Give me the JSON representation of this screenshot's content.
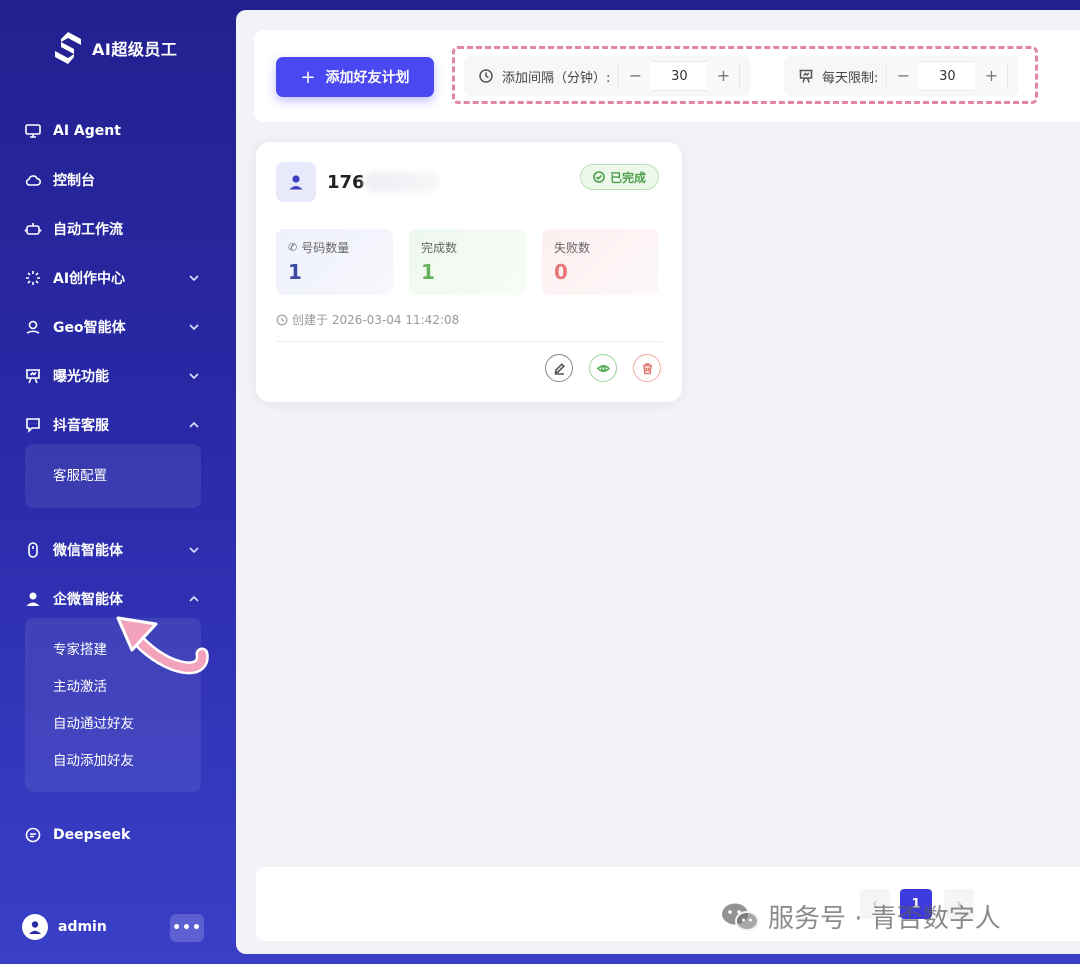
{
  "brand": {
    "name": "AI超级员工"
  },
  "sidebar": {
    "items": [
      {
        "label": "AI Agent",
        "icon": "monitor-icon"
      },
      {
        "label": "控制台",
        "icon": "cloud-icon"
      },
      {
        "label": "自动工作流",
        "icon": "robot-icon"
      },
      {
        "label": "AI创作中心",
        "icon": "sparkle-icon",
        "expanded": false
      },
      {
        "label": "Geo智能体",
        "icon": "map-pin-icon",
        "expanded": false
      },
      {
        "label": "曝光功能",
        "icon": "presentation-icon",
        "expanded": false
      },
      {
        "label": "抖音客服",
        "icon": "chat-icon",
        "expanded": true
      },
      {
        "label": "微信智能体",
        "icon": "mouse-icon",
        "expanded": false
      },
      {
        "label": "企微智能体",
        "icon": "user-icon",
        "expanded": true
      },
      {
        "label": "Deepseek",
        "icon": "message-icon"
      }
    ],
    "douyin_sub": [
      "客服配置"
    ],
    "qiwei_sub": [
      "专家搭建",
      "主动激活",
      "自动通过好友",
      "自动添加好友"
    ],
    "user": {
      "name": "admin",
      "more": "•••"
    }
  },
  "toolbar": {
    "add_button": "添加好友计划",
    "interval": {
      "label": "添加间隔（分钟）:",
      "value": "30"
    },
    "daily_limit": {
      "label": "每天限制:",
      "value": "30"
    }
  },
  "stepper": {
    "minus": "−",
    "plus": "+"
  },
  "card": {
    "title": "176",
    "status": "已完成",
    "stats": {
      "total": {
        "label": "号码数量",
        "value": "1"
      },
      "done": {
        "label": "完成数",
        "value": "1"
      },
      "fail": {
        "label": "失败数",
        "value": "0"
      }
    },
    "created": "创建于 2026-03-04 11:42:08"
  },
  "pagination": {
    "prev": "‹",
    "current": "1",
    "next": "›"
  },
  "watermark": {
    "text": "服务号 · 青否数字人"
  },
  "colors": {
    "accent": "#4a48f0",
    "sidebar": "#2a2aa8",
    "success": "#4aa04a",
    "danger": "#e6787a",
    "highlight": "#e0889e"
  }
}
